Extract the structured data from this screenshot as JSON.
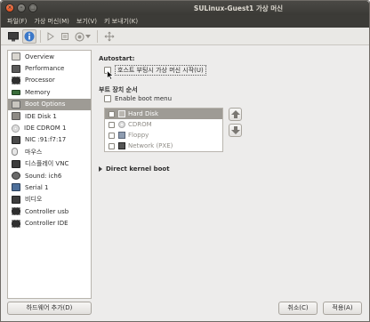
{
  "window": {
    "title": "SULinux-Guest1 가상 머신"
  },
  "menubar": [
    "파일(F)",
    "가상 머신(M)",
    "보기(V)",
    "키 보내기(K)"
  ],
  "toolbar": {
    "buttons": [
      "monitor-icon",
      "info-icon",
      "play-icon",
      "pause-icon",
      "power-icon",
      "power-dropdown-icon",
      "fullscreen-icon"
    ]
  },
  "sidebar": {
    "items": [
      {
        "label": "Overview",
        "icon": "overview-icon"
      },
      {
        "label": "Performance",
        "icon": "performance-icon"
      },
      {
        "label": "Processor",
        "icon": "processor-icon"
      },
      {
        "label": "Memory",
        "icon": "memory-icon"
      },
      {
        "label": "Boot Options",
        "icon": "boot-options-icon",
        "selected": true
      },
      {
        "label": "IDE Disk 1",
        "icon": "disk-icon"
      },
      {
        "label": "IDE CDROM 1",
        "icon": "cdrom-icon"
      },
      {
        "label": "NIC :91:f7:17",
        "icon": "nic-icon"
      },
      {
        "label": "마우스",
        "icon": "mouse-icon"
      },
      {
        "label": "디스플레이 VNC",
        "icon": "display-icon"
      },
      {
        "label": "Sound: ich6",
        "icon": "sound-icon"
      },
      {
        "label": "Serial 1",
        "icon": "serial-icon"
      },
      {
        "label": "비디오",
        "icon": "video-icon"
      },
      {
        "label": "Controller usb",
        "icon": "controller-icon"
      },
      {
        "label": "Controller IDE",
        "icon": "controller-icon"
      }
    ],
    "add_hardware_label": "하드웨어 추가(D)"
  },
  "content": {
    "autostart": {
      "title": "Autostart:",
      "checkbox_label": "호스트 부팅시 가상 머신 시작(U)",
      "checked": false
    },
    "boot_order": {
      "title": "부트 장치 순서",
      "enable_menu_label": "Enable boot menu",
      "enable_menu_checked": false,
      "devices": [
        {
          "label": "Hard Disk",
          "checked": false,
          "selected": true,
          "icon": "harddisk-icon"
        },
        {
          "label": "CDROM",
          "checked": false,
          "selected": false,
          "icon": "cdrom-icon"
        },
        {
          "label": "Floppy",
          "checked": false,
          "selected": false,
          "icon": "floppy-icon"
        },
        {
          "label": "Network (PXE)",
          "checked": false,
          "selected": false,
          "icon": "network-icon"
        }
      ]
    },
    "direct_kernel_boot": {
      "label": "Direct kernel boot",
      "expanded": false
    }
  },
  "buttons": {
    "cancel": "취소(C)",
    "apply": "적용(A)"
  },
  "colors": {
    "selection": "#9e9b95",
    "titlebar": "#3c3b37",
    "close": "#e95420"
  }
}
